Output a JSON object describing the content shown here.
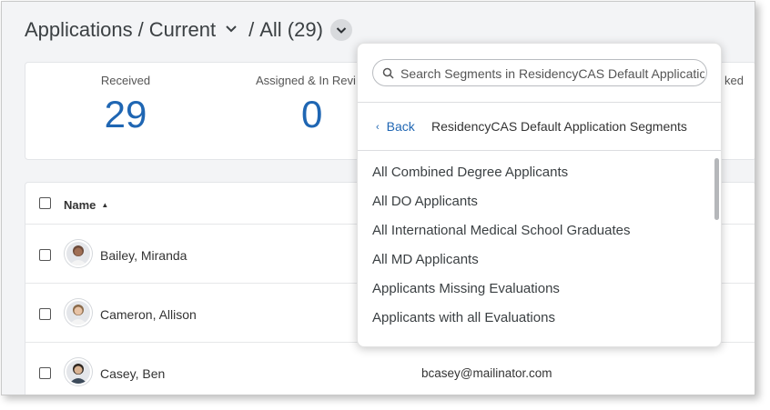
{
  "breadcrumb": {
    "part1": "Applications",
    "sep1": "/",
    "part2": "Current",
    "sep2": "/",
    "part3": "All (29)"
  },
  "stats": [
    {
      "label": "Received",
      "value": "29"
    },
    {
      "label": "Assigned & In Revi",
      "value": "0"
    },
    {
      "label": "ked",
      "value": ""
    }
  ],
  "table": {
    "header_name": "Name",
    "sort_icon": "▲",
    "rows": [
      {
        "name": "Bailey, Miranda",
        "email": ""
      },
      {
        "name": "Cameron, Allison",
        "email": ""
      },
      {
        "name": "Casey, Ben",
        "email": "bcasey@mailinator.com"
      }
    ]
  },
  "dropdown": {
    "search_placeholder": "Search Segments in ResidencyCAS Default Applications",
    "back_label": "Back",
    "back_icon": "‹",
    "title": "ResidencyCAS Default Application Segments",
    "segments": [
      "All Combined Degree Applicants",
      "All DO Applicants",
      "All International Medical School Graduates",
      "All MD Applicants",
      "Applicants Missing Evaluations",
      "Applicants with all Evaluations"
    ]
  },
  "colors": {
    "accent": "#1f66b3",
    "background": "#f3f4f6"
  }
}
